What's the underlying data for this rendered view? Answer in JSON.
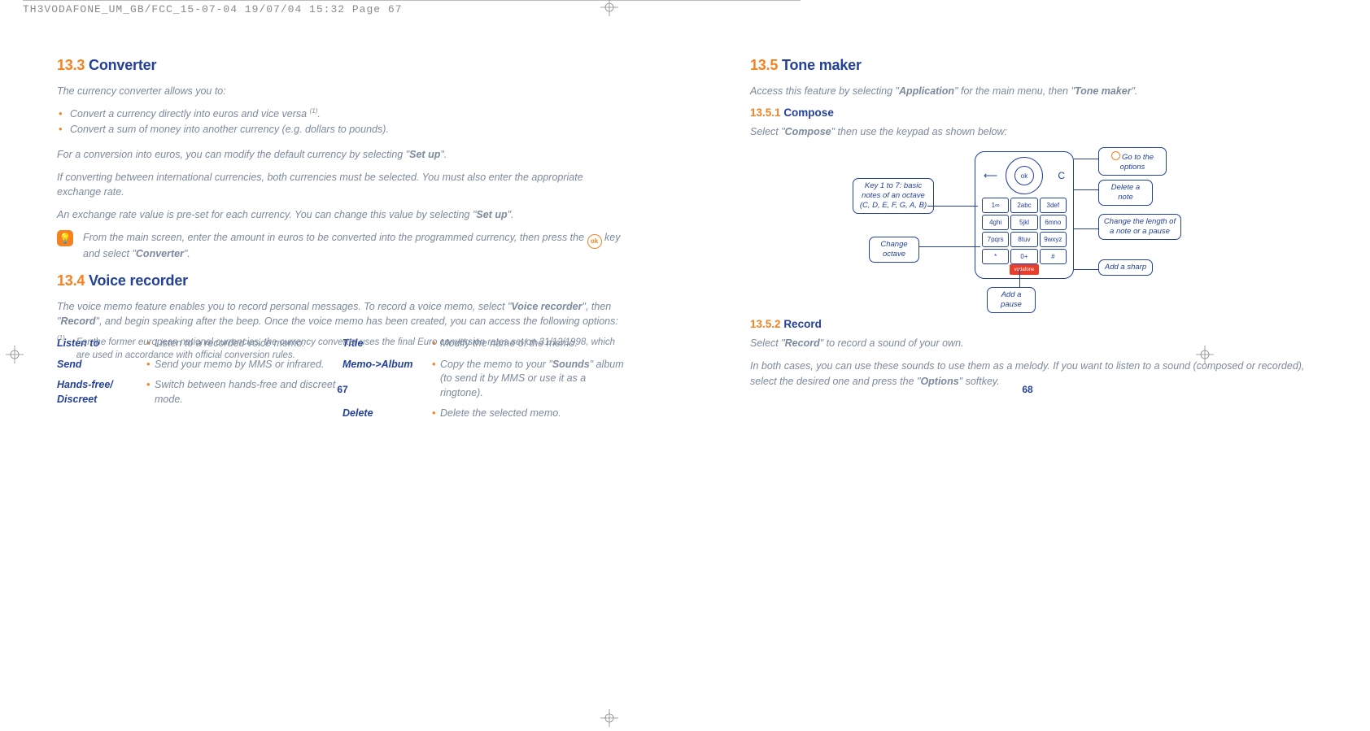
{
  "header": "TH3VODAFONE_UM_GB/FCC_15-07-04  19/07/04  15:32  Page 67",
  "left": {
    "s133": {
      "num": "13.3",
      "title": "Converter",
      "intro": "The currency converter allows you to:",
      "bullets": [
        "Convert a currency directly into euros and vice versa",
        "Convert a sum of money into another currency (e.g. dollars to pounds)."
      ],
      "footref": "(1)",
      "p1a": "For a conversion into euros, you can modify the default currency by selecting \"",
      "p1b": "Set up",
      "p1c": "\".",
      "p2": "If converting between international currencies, both currencies must be selected. You must also enter the appropriate exchange rate.",
      "p3a": "An exchange rate value is pre-set for each currency. You can change this value by selecting \"",
      "p3b": "Set up",
      "p3c": "\".",
      "tip_a": "From the main screen, enter the amount in euros to be converted into the programmed currency, then press the ",
      "tip_b": " key and select \"",
      "tip_c": "Converter",
      "tip_d": "\"."
    },
    "s134": {
      "num": "13.4",
      "title": "Voice recorder",
      "intro_a": "The voice memo feature enables you to record personal messages. To record a voice memo, select \"",
      "intro_b": "Voice recorder",
      "intro_c": "\", then \"",
      "intro_d": "Record",
      "intro_e": "\", and begin speaking after the beep. Once the voice memo has been created, you can access the following options:",
      "left_opts": [
        {
          "label": "Listen to",
          "desc": "Listen to a recorded voice memo."
        },
        {
          "label": "Send",
          "desc": "Send your memo by MMS or infrared."
        },
        {
          "label": "Hands-free/ Discreet",
          "desc": "Switch between hands-free and discreet mode."
        }
      ],
      "right_opts": [
        {
          "label": "Title",
          "desc": "Modify the name of the memo."
        },
        {
          "label": "Memo->Album",
          "desc_a": "Copy the memo to your \"",
          "desc_b": "Sounds",
          "desc_c": "\" album (to send it by MMS or use it as a ringtone)."
        },
        {
          "label": "Delete",
          "desc": "Delete the selected memo."
        }
      ]
    },
    "footnote": {
      "num": "(1)",
      "text": "For the former european national currencies, the currency converter uses the final Euro conversion rates set on 31/12/1998, which are used in accordance with official conversion rules."
    },
    "pagenum": "67"
  },
  "right": {
    "s135": {
      "num": "13.5",
      "title": "Tone maker",
      "intro_a": "Access this feature by selecting \"",
      "intro_b": "Application",
      "intro_c": "\" for the main menu, then \"",
      "intro_d": "Tone maker",
      "intro_e": "\"."
    },
    "s1351": {
      "num": "13.5.1",
      "title": "Compose",
      "text_a": "Select \"",
      "text_b": "Compose",
      "text_c": "\" then use the keypad as shown below:"
    },
    "callouts": {
      "c1": "Key 1 to 7: basic notes of an octave (C, D, E, F, G, A, B)",
      "c2": "Change octave",
      "c3": "Add a pause",
      "c4": "Go to the options",
      "c5": "Delete a note",
      "c6": "Change the length of a note or a pause",
      "c7": "Add a sharp"
    },
    "keypad": {
      "ok": "ok",
      "keys": [
        "1∞",
        "2abc",
        "3def",
        "4ghi",
        "5jkl",
        "6mno",
        "7pqrs",
        "8tuv",
        "9wxyz",
        "*",
        "0+",
        "#"
      ],
      "brand": "vodafone"
    },
    "s1352": {
      "num": "13.5.2",
      "title": "Record",
      "p1a": "Select \"",
      "p1b": "Record",
      "p1c": "\" to record a sound of your own.",
      "p2a": "In both cases, you can use these sounds to use them as a melody. If you want to listen to a sound (composed or recorded), select the desired one and press the \"",
      "p2b": "Options",
      "p2c": "\" softkey."
    },
    "pagenum": "68"
  }
}
